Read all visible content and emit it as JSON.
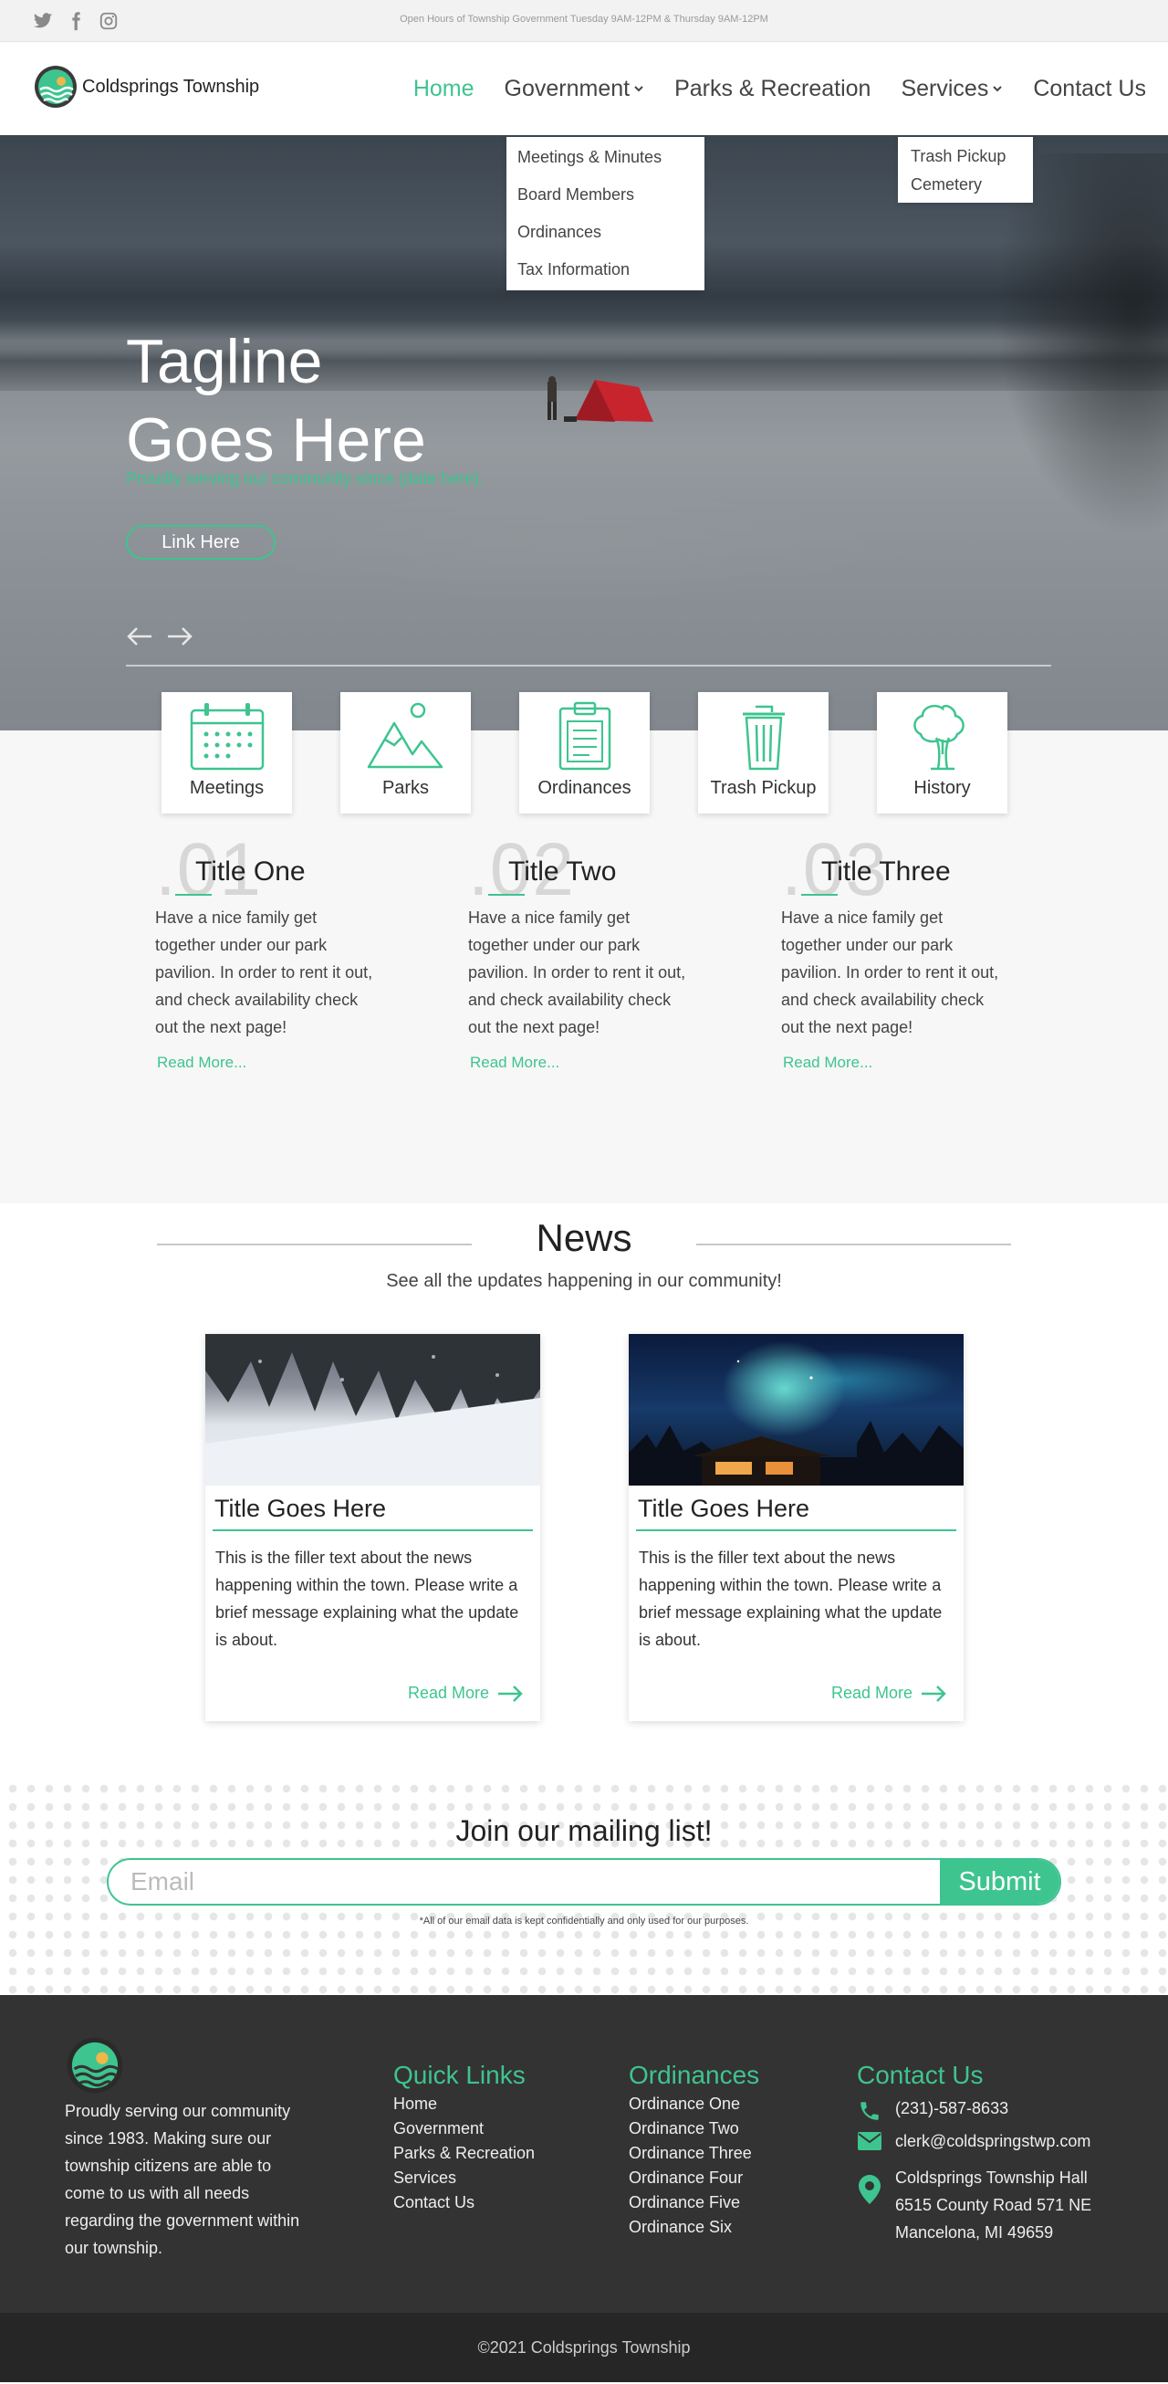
{
  "topbar": {
    "hours": "Open Hours of Township Government Tuesday 9AM-12PM & Thursday 9AM-12PM",
    "socials": [
      "twitter-icon",
      "facebook-icon",
      "instagram-icon"
    ]
  },
  "header": {
    "logo_text": "Coldsprings Township",
    "nav": {
      "home": "Home",
      "government": "Government",
      "parks": "Parks & Recreation",
      "services": "Services",
      "contact": "Contact Us"
    },
    "government_menu": [
      "Meetings & Minutes",
      "Board Members",
      "Ordinances",
      "Tax Information"
    ],
    "services_menu": [
      "Trash Pickup",
      "Cemetery"
    ]
  },
  "hero": {
    "tagline_line1": "Tagline",
    "tagline_line2": "Goes Here",
    "subtitle": "Proudly serving our community since (date here).",
    "button": "Link Here"
  },
  "tiles": [
    {
      "label": "Meetings",
      "icon": "calendar-icon"
    },
    {
      "label": "Parks",
      "icon": "mountain-icon"
    },
    {
      "label": "Ordinances",
      "icon": "clipboard-icon"
    },
    {
      "label": "Trash Pickup",
      "icon": "trash-icon"
    },
    {
      "label": "History",
      "icon": "tree-icon"
    }
  ],
  "features": [
    {
      "num": ".01",
      "title": "Title One",
      "text": "Have a nice family get together under our park pavilion. In order to rent it out, and check availability check out the next page!",
      "link": "Read More..."
    },
    {
      "num": ".02",
      "title": "Title Two",
      "text": "Have a nice family get together under our park pavilion. In order to rent it out, and check availability check out the next page!",
      "link": "Read More..."
    },
    {
      "num": ".03",
      "title": "Title Three",
      "text": "Have a nice family get together under our park pavilion. In order to rent it out, and check availability check out the next page!",
      "link": "Read More..."
    }
  ],
  "news": {
    "title": "News",
    "subtitle": "See all the updates happening in our community!",
    "cards": [
      {
        "title": "Title Goes Here",
        "text": "This is the filler text about the news happening within the town. Please write a brief message explaining what the update is about.",
        "link": "Read More"
      },
      {
        "title": "Title Goes Here",
        "text": "This is the filler text about the news happening within the town. Please write a brief message explaining what the update is about.",
        "link": "Read More"
      }
    ]
  },
  "mailing": {
    "title": "Join our mailing list!",
    "placeholder": "Email",
    "button": "Submit",
    "note": "*All of our email data is kept confidentially and only used for our purposes."
  },
  "footer": {
    "about": "Proudly serving our community since 1983. Making sure our township citizens are able to come to us with all needs regarding the government within our township.",
    "quick_links_title": "Quick Links",
    "quick_links": [
      "Home",
      "Government",
      "Parks & Recreation",
      "Services",
      "Contact Us"
    ],
    "ordinances_title": "Ordinances",
    "ordinances": [
      "Ordinance One",
      "Ordinance Two",
      "Ordinance Three",
      "Ordinance Four",
      "Ordinance Five",
      "Ordinance Six"
    ],
    "contact_title": "Contact Us",
    "phone": "(231)-587-8633",
    "email": "clerk@coldspringstwp.com",
    "address_line1": "Coldsprings Township Hall",
    "address_line2": "6515 County Road 571 NE",
    "address_line3": "Mancelona, MI 49659",
    "copyright": "©2021 Coldsprings Township"
  },
  "colors": {
    "accent": "#3ec48f",
    "footer_bg": "#333333",
    "footer_bottom": "#262626"
  }
}
